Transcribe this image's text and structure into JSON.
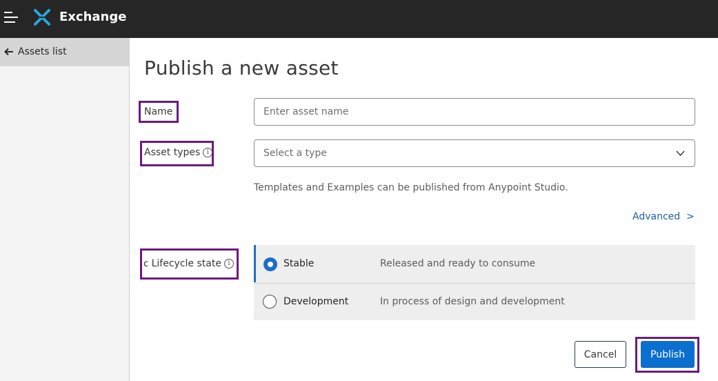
{
  "header": {
    "app_title": "Exchange"
  },
  "sidebar": {
    "back_label": "Assets list"
  },
  "page": {
    "title": "Publish a new asset"
  },
  "form": {
    "name_label": "Name",
    "name_placeholder": "Enter asset name",
    "asset_types_label": "Asset types",
    "asset_types_placeholder": "Select a type",
    "helper_text": "Templates and Examples can be published from Anypoint Studio.",
    "advanced_link": "Advanced  >",
    "lifecycle_label": "Lifecycle state",
    "lifecycle_options": [
      {
        "name": "Stable",
        "description": "Released and ready to consume",
        "selected": true
      },
      {
        "name": "Development",
        "description": "In process of design and development",
        "selected": false
      }
    ]
  },
  "actions": {
    "cancel_label": "Cancel",
    "publish_label": "Publish"
  },
  "colors": {
    "topbar": "#262626",
    "accent": "#0b6fd0",
    "highlight": "#6b1a7e",
    "sidebar": "#f3f3f3"
  },
  "icons": [
    "hamburger-icon",
    "exchange-logo-icon",
    "back-arrow-icon",
    "info-icon",
    "chevron-down-icon"
  ]
}
